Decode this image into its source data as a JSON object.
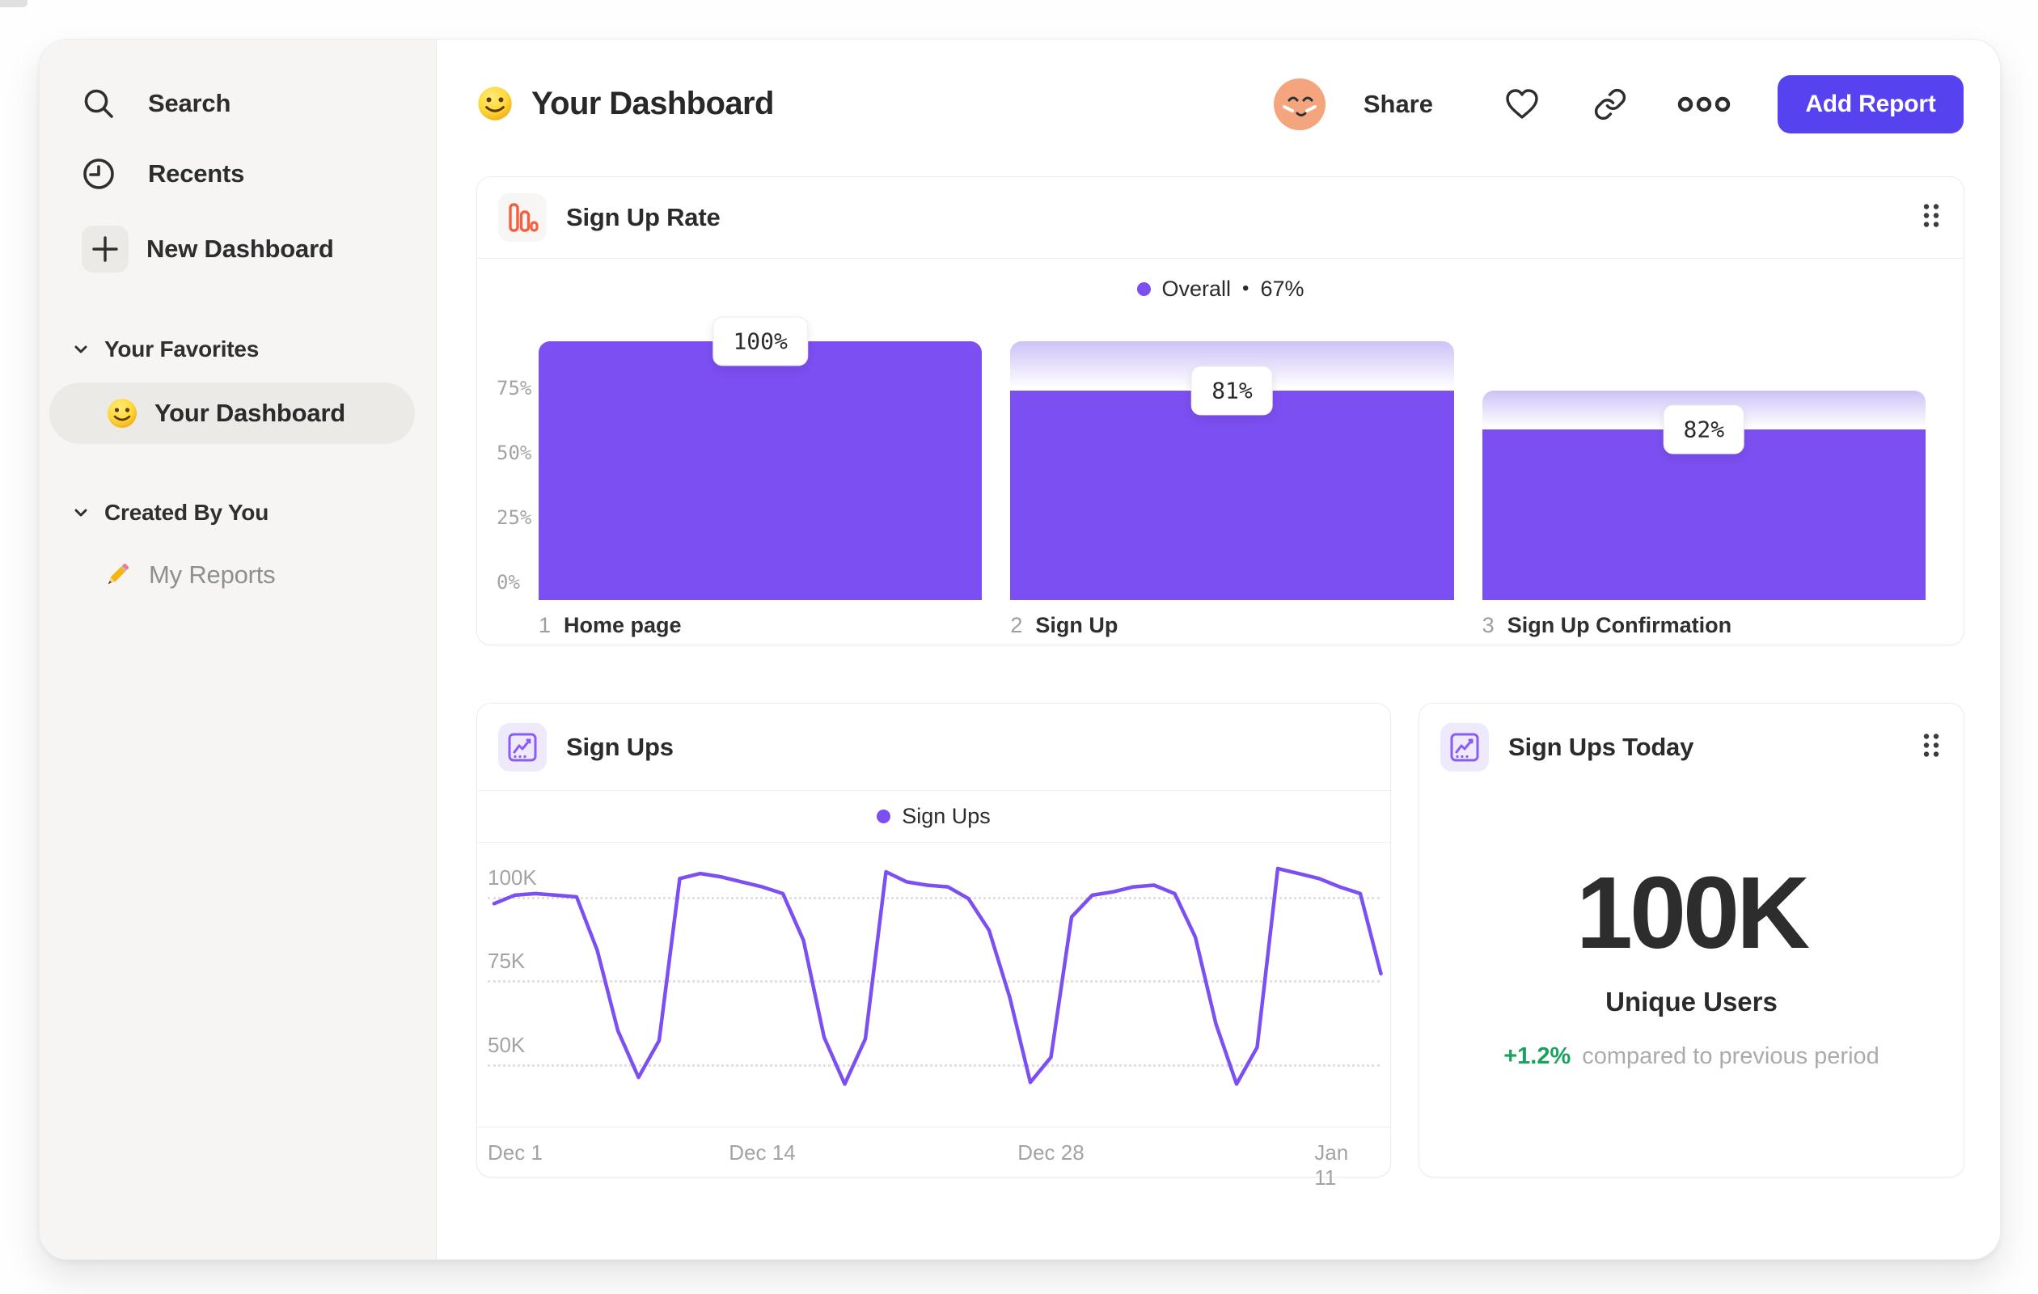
{
  "sidebar": {
    "nav": [
      {
        "label": "Search"
      },
      {
        "label": "Recents"
      },
      {
        "label": "New Dashboard"
      }
    ],
    "sections": [
      {
        "label": "Your Favorites",
        "items": [
          {
            "label": "Your Dashboard",
            "selected": true,
            "icon": "smiley-emoji"
          }
        ]
      },
      {
        "label": "Created By You",
        "items": [
          {
            "label": "My Reports",
            "selected": false,
            "icon": "pencil-emoji"
          }
        ]
      }
    ]
  },
  "header": {
    "title": "Your Dashboard",
    "share": "Share",
    "add_report": "Add Report"
  },
  "cards": {
    "funnel": {
      "title": "Sign Up Rate",
      "legend": {
        "name": "Overall",
        "separator": "•",
        "value": "67%"
      }
    },
    "line": {
      "title": "Sign Ups",
      "legend": "Sign Ups"
    },
    "stat": {
      "title": "Sign Ups Today",
      "value": "100K",
      "sublabel": "Unique Users",
      "delta": "+1.2%",
      "delta_note": "compared to previous period"
    }
  },
  "colors": {
    "accent_purple": "#7c4ff2",
    "button_indigo": "#5742ef",
    "funnel_icon_orange": "#f2603f",
    "positive_green": "#17a35b",
    "gradient_light_purple": "#cdc2f6"
  },
  "chart_data": [
    {
      "type": "bar",
      "subtype": "funnel",
      "title": "Sign Up Rate",
      "overall_conversion_pct": 67,
      "legend": "Overall • 67%",
      "ylim": [
        0,
        100
      ],
      "grid": false,
      "y_ticks": [
        {
          "label": "75%",
          "pct": 75
        },
        {
          "label": "50%",
          "pct": 50
        },
        {
          "label": "25%",
          "pct": 25
        },
        {
          "label": "0%",
          "pct": 0
        }
      ],
      "steps": [
        {
          "step": 1,
          "label": "Home page",
          "conversion_label": "100%",
          "conversion_from_previous_pct": 100,
          "pct_of_total": 100,
          "prev_pct_of_total": null
        },
        {
          "step": 2,
          "label": "Sign Up",
          "conversion_label": "81%",
          "conversion_from_previous_pct": 81,
          "pct_of_total": 81,
          "prev_pct_of_total": 100
        },
        {
          "step": 3,
          "label": "Sign Up Confirmation",
          "conversion_label": "82%",
          "conversion_from_previous_pct": 82,
          "pct_of_total": 66,
          "prev_pct_of_total": 81
        }
      ]
    },
    {
      "type": "line",
      "title": "Sign Ups",
      "legend": [
        "Sign Ups"
      ],
      "xlabel": "",
      "ylabel": "",
      "ylim_k": [
        40,
        112
      ],
      "grid": "dotted-horizontal",
      "y_ticks": [
        {
          "label": "100K",
          "value_k": 100
        },
        {
          "label": "75K",
          "value_k": 75
        },
        {
          "label": "50K",
          "value_k": 50
        }
      ],
      "x_ticks": [
        {
          "label": "Dec 1",
          "day": 0
        },
        {
          "label": "Dec 14",
          "day": 13
        },
        {
          "label": "Dec 28",
          "day": 27
        },
        {
          "label": "Jan 11",
          "day": 41
        }
      ],
      "series": [
        {
          "name": "Sign Ups",
          "unit": "K",
          "days": [
            0,
            1,
            2,
            3,
            4,
            5,
            6,
            7,
            8,
            9,
            10,
            11,
            12,
            13,
            14,
            15,
            16,
            17,
            18,
            19,
            20,
            21,
            22,
            23,
            24,
            25,
            26,
            27,
            28,
            29,
            30,
            31,
            32,
            33,
            34,
            35,
            36,
            37,
            38,
            39,
            40,
            41,
            42,
            43
          ],
          "values_k": [
            98,
            100.5,
            101,
            100.5,
            100,
            84,
            60,
            46,
            57,
            105.5,
            107,
            106,
            104.5,
            103,
            101,
            87,
            58,
            44,
            57.5,
            107.5,
            104.5,
            103.5,
            103,
            99.5,
            90,
            70,
            44.5,
            52,
            94,
            100.5,
            101.5,
            103,
            103.5,
            101,
            88,
            62,
            44,
            55,
            108.5,
            107,
            105.5,
            103,
            101,
            77
          ]
        }
      ]
    }
  ]
}
